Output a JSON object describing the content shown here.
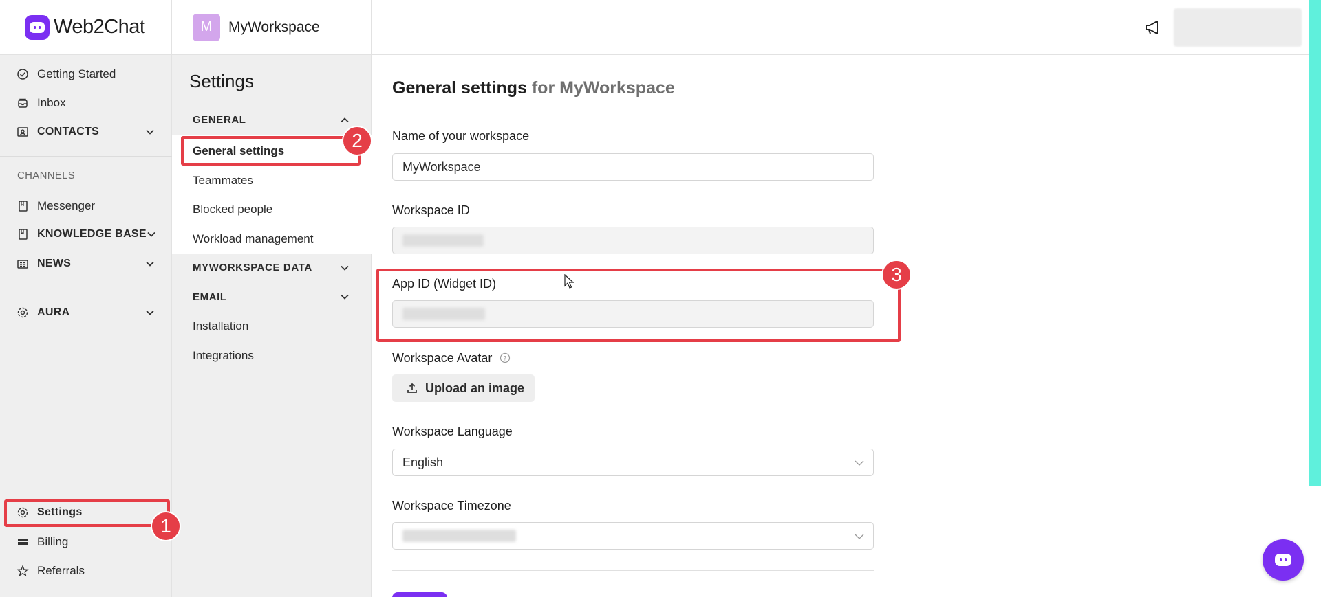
{
  "brand": {
    "name": "Web2Chat"
  },
  "sidebar": {
    "items": [
      {
        "label": "Getting Started",
        "icon": "check-circle-icon"
      },
      {
        "label": "Inbox",
        "icon": "inbox-icon"
      },
      {
        "label": "CONTACTS",
        "icon": "contacts-icon"
      }
    ],
    "channels_label": "CHANNELS",
    "channel_items": [
      {
        "label": "Messenger",
        "icon": "bookmark-icon"
      },
      {
        "label": "KNOWLEDGE BASE",
        "icon": "bookmark-icon"
      },
      {
        "label": "NEWS",
        "icon": "news-icon"
      }
    ],
    "aura_label": "AURA",
    "bottom_items": [
      {
        "label": "Settings",
        "icon": "gear-icon"
      },
      {
        "label": "Billing",
        "icon": "card-icon"
      },
      {
        "label": "Referrals",
        "icon": "star-icon"
      }
    ]
  },
  "workspace": {
    "initial": "M",
    "name": "MyWorkspace"
  },
  "settings_panel": {
    "title": "Settings",
    "general_group": "GENERAL",
    "general_items": [
      "General settings",
      "Teammates",
      "Blocked people",
      "Workload management"
    ],
    "data_group": "MYWORKSPACE DATA",
    "email_group": "EMAIL",
    "other_items": [
      "Installation",
      "Integrations"
    ]
  },
  "main": {
    "title": "General settings",
    "title_suffix": "for MyWorkspace",
    "name_label": "Name of your workspace",
    "name_value": "MyWorkspace",
    "workspace_id_label": "Workspace ID",
    "app_id_label": "App ID (Widget ID)",
    "avatar_label": "Workspace Avatar",
    "upload_label": "Upload an image",
    "language_label": "Workspace Language",
    "language_value": "English",
    "timezone_label": "Workspace Timezone"
  },
  "annotations": [
    "1",
    "2",
    "3"
  ],
  "colors": {
    "accent": "#7b2ff2",
    "highlight": "#e53e47",
    "teal": "#5ff0dc"
  }
}
